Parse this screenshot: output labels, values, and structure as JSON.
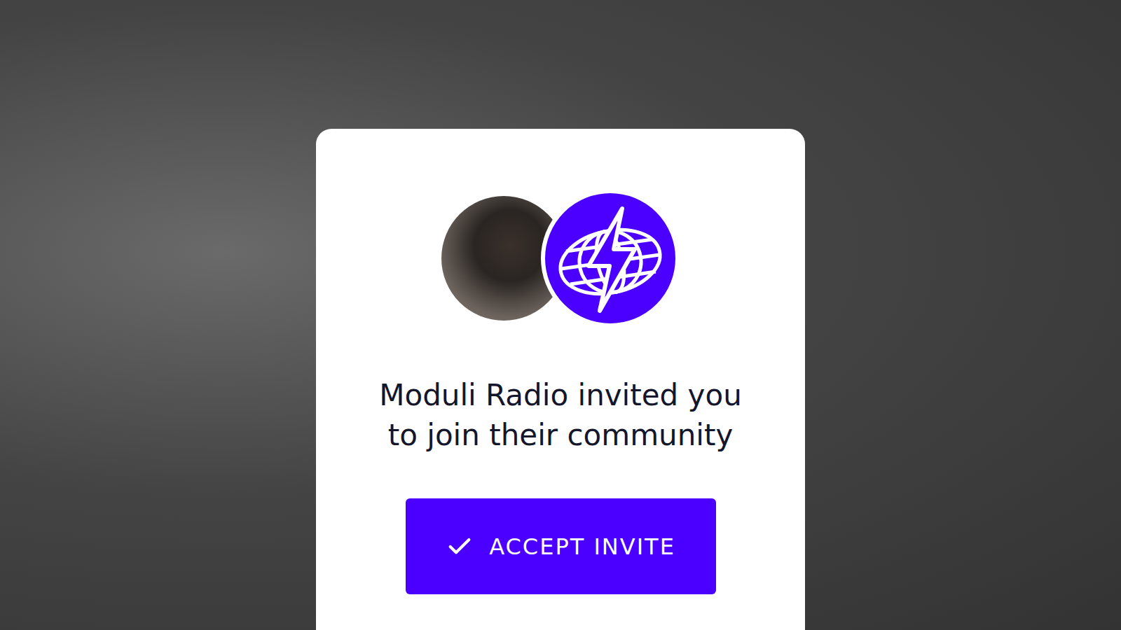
{
  "invite": {
    "message_lines": [
      "Moduli Radio invited you",
      "to join their community"
    ],
    "button": {
      "label": "ACCEPT INVITE"
    }
  }
}
